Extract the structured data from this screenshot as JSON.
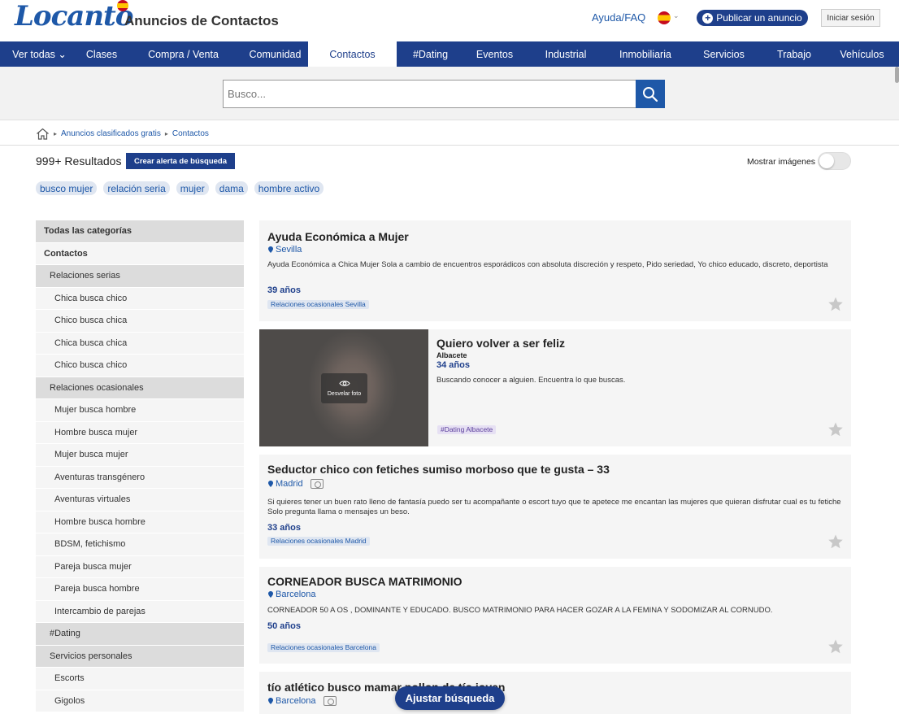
{
  "header": {
    "logo_text": "Locanto",
    "site_title": "Anuncios de Contactos",
    "help_label": "Ayuda/FAQ",
    "publish_label": "Publicar un anuncio",
    "login_label": "Iniciar sesión"
  },
  "nav": {
    "items": [
      {
        "label": "Ver todas ⌄",
        "active": false
      },
      {
        "label": "Clases",
        "active": false
      },
      {
        "label": "Compra / Venta",
        "active": false
      },
      {
        "label": "Comunidad",
        "active": false
      },
      {
        "label": "Contactos",
        "active": true
      },
      {
        "label": "#Dating",
        "active": false
      },
      {
        "label": "Eventos",
        "active": false
      },
      {
        "label": "Industrial",
        "active": false
      },
      {
        "label": "Inmobiliaria",
        "active": false
      },
      {
        "label": "Servicios",
        "active": false
      },
      {
        "label": "Trabajo",
        "active": false
      },
      {
        "label": "Vehículos",
        "active": false
      }
    ]
  },
  "search": {
    "placeholder": "Busco..."
  },
  "breadcrumb": {
    "items": [
      "Anuncios clasificados gratis",
      "Contactos"
    ]
  },
  "results": {
    "count_label": "999+ Resultados",
    "alert_label": "Crear alerta de búsqueda",
    "show_images_label": "Mostrar imágenes"
  },
  "tags": [
    "busco mujer",
    "relación seria",
    "mujer",
    "dama",
    "hombre activo"
  ],
  "sidebar": {
    "items": [
      {
        "label": "Todas las categorías",
        "kind": "top"
      },
      {
        "label": "Contactos",
        "kind": "main"
      },
      {
        "label": "Relaciones serias",
        "kind": "sub"
      },
      {
        "label": "Chica busca chico",
        "kind": "leaf"
      },
      {
        "label": "Chico busca chica",
        "kind": "leaf"
      },
      {
        "label": "Chica busca chica",
        "kind": "leaf"
      },
      {
        "label": "Chico busca chico",
        "kind": "leaf"
      },
      {
        "label": "Relaciones ocasionales",
        "kind": "sub"
      },
      {
        "label": "Mujer busca hombre",
        "kind": "leaf"
      },
      {
        "label": "Hombre busca mujer",
        "kind": "leaf"
      },
      {
        "label": "Mujer busca mujer",
        "kind": "leaf"
      },
      {
        "label": "Aventuras transgénero",
        "kind": "leaf"
      },
      {
        "label": "Aventuras virtuales",
        "kind": "leaf"
      },
      {
        "label": "Hombre busca hombre",
        "kind": "leaf"
      },
      {
        "label": "BDSM, fetichismo",
        "kind": "leaf"
      },
      {
        "label": "Pareja busca mujer",
        "kind": "leaf"
      },
      {
        "label": "Pareja busca hombre",
        "kind": "leaf"
      },
      {
        "label": "Intercambio de parejas",
        "kind": "leaf"
      },
      {
        "label": "#Dating",
        "kind": "sub"
      },
      {
        "label": "Servicios personales",
        "kind": "sub"
      },
      {
        "label": "Escorts",
        "kind": "leaf"
      },
      {
        "label": "Gigolos",
        "kind": "leaf"
      }
    ]
  },
  "listings": [
    {
      "title": "Ayuda Económica a Mujer",
      "location": "Sevilla",
      "description": "Ayuda Económica a Chica Mujer Sola a cambio de encuentros esporádicos con absoluta discreción y respeto, Pido seriedad, Yo chico educado, discreto, deportista",
      "age": "39 años",
      "category": "Relaciones ocasionales Sevilla"
    },
    {
      "title": "Quiero volver a ser feliz",
      "city": "Albacete",
      "age": "34 años",
      "description": "Buscando conocer a alguien. Encuentra lo que buscas.",
      "category": "#Dating Albacete",
      "reveal_label": "Desvelar foto"
    },
    {
      "title": "Seductor chico con fetiches sumiso morboso que te gusta – 33",
      "location": "Madrid",
      "description": "Si quieres tener un buen rato lleno de fantasía puedo ser tu acompañante o escort tuyo que te apetece me encantan las mujeres que quieran disfrutar cual es tu fetiche Solo pregunta llama o mensajes un beso.",
      "age": "33 años",
      "category": "Relaciones ocasionales Madrid"
    },
    {
      "title": "CORNEADOR BUSCA MATRIMONIO",
      "location": "Barcelona",
      "description": "CORNEADOR 50 A OS , DOMINANTE Y EDUCADO. BUSCO MATRIMONIO PARA HACER GOZAR A LA FEMINA Y SODOMIZAR AL CORNUDO.",
      "age": "50 años",
      "category": "Relaciones ocasionales Barcelona"
    },
    {
      "title": "tío atlético busco mamar pollon de tío joven",
      "location": "Barcelona"
    }
  ],
  "adjust_label": "Ajustar búsqueda",
  "colors": {
    "brand_blue": "#1e3f8b",
    "link_blue": "#1e58a8"
  }
}
